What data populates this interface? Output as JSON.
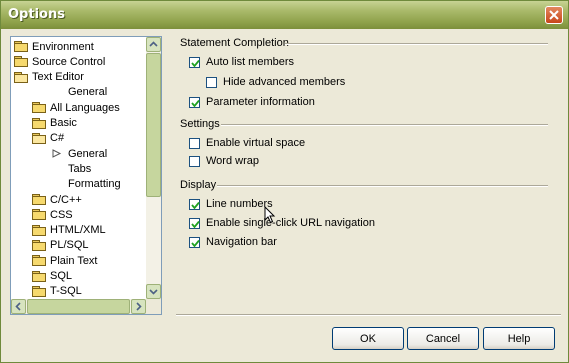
{
  "window": {
    "title": "Options"
  },
  "tree": {
    "items": [
      {
        "label": "Environment",
        "icon": "folder-icon"
      },
      {
        "label": "Source Control",
        "icon": "folder-icon"
      },
      {
        "label": "Text Editor",
        "icon": "folder-open-icon"
      },
      {
        "label": "General",
        "icon": ""
      },
      {
        "label": "All Languages",
        "icon": "folder-icon"
      },
      {
        "label": "Basic",
        "icon": "folder-icon"
      },
      {
        "label": "C#",
        "icon": "folder-open-icon"
      },
      {
        "label": "General",
        "icon": "arrow-icon"
      },
      {
        "label": "Tabs",
        "icon": ""
      },
      {
        "label": "Formatting",
        "icon": ""
      },
      {
        "label": "C/C++",
        "icon": "folder-icon"
      },
      {
        "label": "CSS",
        "icon": "folder-icon"
      },
      {
        "label": "HTML/XML",
        "icon": "folder-icon"
      },
      {
        "label": "PL/SQL",
        "icon": "folder-icon"
      },
      {
        "label": "Plain Text",
        "icon": "folder-icon"
      },
      {
        "label": "SQL",
        "icon": "folder-icon"
      },
      {
        "label": "T-SQL",
        "icon": "folder-icon"
      }
    ],
    "selected": "General (C#)"
  },
  "groups": {
    "statement_completion": {
      "title": "Statement Completion",
      "options": [
        {
          "label": "Auto list members",
          "checked": true
        },
        {
          "label": "Hide advanced members",
          "checked": false
        },
        {
          "label": "Parameter information",
          "checked": true
        }
      ]
    },
    "settings": {
      "title": "Settings",
      "options": [
        {
          "label": "Enable virtual space",
          "checked": false
        },
        {
          "label": "Word wrap",
          "checked": false
        }
      ]
    },
    "display": {
      "title": "Display",
      "options": [
        {
          "label": "Line numbers",
          "checked": true
        },
        {
          "label": "Enable single-click URL navigation",
          "checked": true
        },
        {
          "label": "Navigation bar",
          "checked": true
        }
      ]
    }
  },
  "buttons": {
    "ok": "OK",
    "cancel": "Cancel",
    "help": "Help"
  },
  "colors": {
    "titlebar": "#8fa24b",
    "dialog_bg": "#ece9d8",
    "folder": "#f6d96e"
  }
}
